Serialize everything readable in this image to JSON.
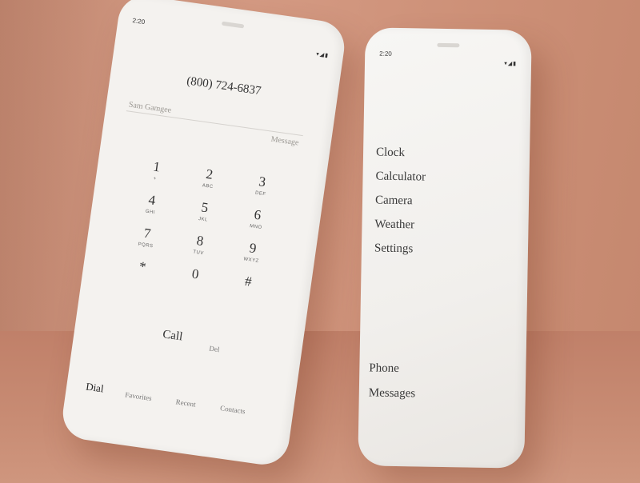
{
  "dialer": {
    "status_time": "2:20",
    "status_icons": "▾◢▮",
    "number": "(800) 724-6837",
    "contact_name": "Sam Gamgee",
    "message_label": "Message",
    "keys": [
      {
        "digit": "1",
        "letters": "+"
      },
      {
        "digit": "2",
        "letters": "ABC"
      },
      {
        "digit": "3",
        "letters": "DEF"
      },
      {
        "digit": "4",
        "letters": "GHI"
      },
      {
        "digit": "5",
        "letters": "JKL"
      },
      {
        "digit": "6",
        "letters": "MNO"
      },
      {
        "digit": "7",
        "letters": "PQRS"
      },
      {
        "digit": "8",
        "letters": "TUV"
      },
      {
        "digit": "9",
        "letters": "WXYZ"
      },
      {
        "digit": "*",
        "letters": ""
      },
      {
        "digit": "0",
        "letters": ""
      },
      {
        "digit": "#",
        "letters": ""
      }
    ],
    "call_label": "Call",
    "del_label": "Del",
    "tabs": [
      "Dial",
      "Favorites",
      "Recent",
      "Contacts"
    ]
  },
  "launcher": {
    "status_time": "2:20",
    "status_icons": "▾◢▮",
    "apps": [
      "Clock",
      "Calculator",
      "Camera",
      "Weather",
      "Settings"
    ],
    "dock": [
      "Phone",
      "Messages"
    ]
  }
}
